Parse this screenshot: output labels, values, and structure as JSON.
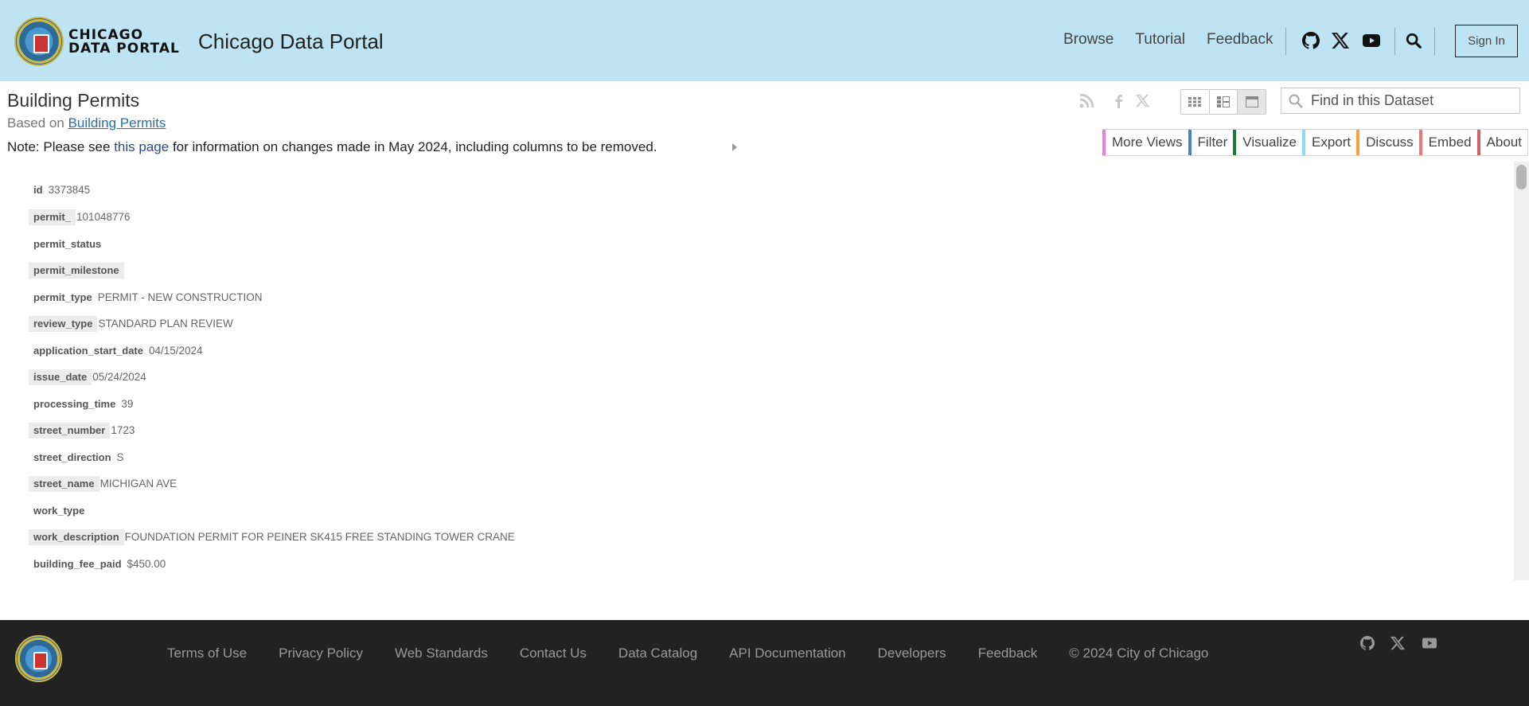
{
  "header": {
    "logo_text_line1": "CHICAGO",
    "logo_text_line2": "DATA PORTAL",
    "site_title": "Chicago Data Portal",
    "nav": [
      "Browse",
      "Tutorial",
      "Feedback"
    ],
    "icons": [
      "github-icon",
      "x-icon",
      "youtube-icon",
      "search-icon"
    ],
    "sign_in": "Sign In"
  },
  "dataset": {
    "title": "Building Permits",
    "based_on_prefix": "Based on",
    "based_on_link": "Building Permits",
    "note_prefix": "Note: Please see",
    "note_link": "this page",
    "note_suffix": "for information on changes made in May 2024, including columns to be removed.",
    "share_icons": [
      "rss-icon",
      "facebook-icon",
      "x-icon"
    ],
    "view_modes": [
      "grid-view",
      "list-view",
      "row-view"
    ],
    "active_view": "row-view",
    "search_placeholder": "Find in this Dataset",
    "actions": [
      {
        "label": "More Views",
        "color": "#e97ee4"
      },
      {
        "label": "Filter",
        "color": "#3f88c5"
      },
      {
        "label": "Visualize",
        "color": "#1a7a3f"
      },
      {
        "label": "Export",
        "color": "#8adcf2"
      },
      {
        "label": "Discuss",
        "color": "#f5a142"
      },
      {
        "label": "Embed",
        "color": "#f07675"
      },
      {
        "label": "About",
        "color": "#d0606a"
      }
    ]
  },
  "record": {
    "fields": [
      {
        "name": "id",
        "value": "3373845"
      },
      {
        "name": "permit_",
        "value": "101048776"
      },
      {
        "name": "permit_status",
        "value": ""
      },
      {
        "name": "permit_milestone",
        "value": ""
      },
      {
        "name": "permit_type",
        "value": "PERMIT - NEW CONSTRUCTION"
      },
      {
        "name": "review_type",
        "value": "STANDARD PLAN REVIEW"
      },
      {
        "name": "application_start_date",
        "value": "04/15/2024"
      },
      {
        "name": "issue_date",
        "value": "05/24/2024"
      },
      {
        "name": "processing_time",
        "value": "39"
      },
      {
        "name": "street_number",
        "value": "1723"
      },
      {
        "name": "street_direction",
        "value": "S"
      },
      {
        "name": "street_name",
        "value": "MICHIGAN AVE"
      },
      {
        "name": "work_type",
        "value": ""
      },
      {
        "name": "work_description",
        "value": "FOUNDATION PERMIT FOR PEINER SK415 FREE STANDING TOWER CRANE"
      },
      {
        "name": "building_fee_paid",
        "value": "$450.00"
      }
    ]
  },
  "footer": {
    "links": [
      "Terms of Use",
      "Privacy Policy",
      "Web Standards",
      "Contact Us",
      "Data Catalog",
      "API Documentation",
      "Developers",
      "Feedback"
    ],
    "copyright": "© 2024 City of Chicago",
    "icons": [
      "github-icon",
      "x-icon",
      "youtube-icon"
    ]
  }
}
